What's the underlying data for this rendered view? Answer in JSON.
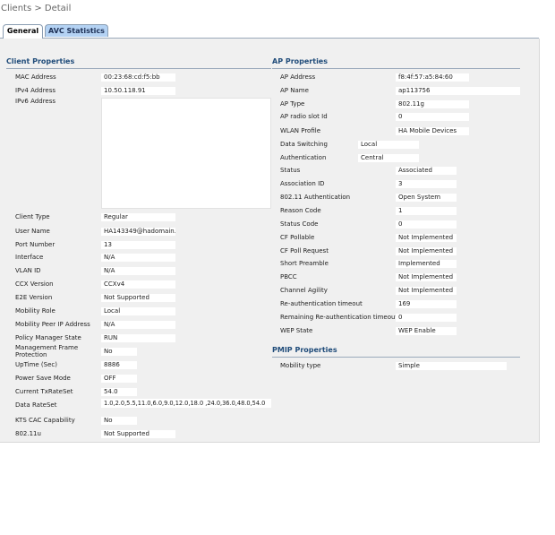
{
  "breadcrumb": "Clients > Detail",
  "tabs": [
    "General",
    "AVC Statistics"
  ],
  "client_properties": {
    "title": "Client Properties",
    "rows": [
      {
        "label": "MAC Address",
        "value": "00:23:68:cd:f5:bb"
      },
      {
        "label": "IPv4 Address",
        "value": "10.50.118.91"
      },
      {
        "label": "IPv6 Address",
        "value": ""
      },
      {
        "label": "Client Type",
        "value": "Regular"
      },
      {
        "label": "User Name",
        "value": "HA143349@hadomain.n"
      },
      {
        "label": "Port Number",
        "value": "13"
      },
      {
        "label": "Interface",
        "value": "N/A"
      },
      {
        "label": "VLAN ID",
        "value": "N/A"
      },
      {
        "label": "CCX Version",
        "value": "CCXv4"
      },
      {
        "label": "E2E Version",
        "value": "Not Supported"
      },
      {
        "label": "Mobility Role",
        "value": "Local"
      },
      {
        "label": "Mobility Peer IP Address",
        "value": "N/A"
      },
      {
        "label": "Policy Manager State",
        "value": "RUN"
      },
      {
        "label": "Management Frame Protection",
        "value": "No"
      },
      {
        "label": "UpTime (Sec)",
        "value": "8886"
      },
      {
        "label": "Power Save Mode",
        "value": "OFF"
      },
      {
        "label": "Current TxRateSet",
        "value": "54.0"
      },
      {
        "label": "Data RateSet",
        "value": "1.0,2.0,5.5,11.0,6.0,9.0,12.0,18.0 ,24.0,36.0,48.0,54.0"
      },
      {
        "label": "KTS CAC Capability",
        "value": "No"
      },
      {
        "label": "802.11u",
        "value": "Not Supported"
      }
    ]
  },
  "ap_properties": {
    "title": "AP Properties",
    "rows": [
      {
        "label": "AP Address",
        "value": "f8:4f:57:a5:84:60"
      },
      {
        "label": "AP Name",
        "value": "ap113756"
      },
      {
        "label": "AP Type",
        "value": "802.11g"
      },
      {
        "label": "AP radio slot Id",
        "value": "0"
      },
      {
        "label": "WLAN Profile",
        "value": "HA Mobile Devices"
      },
      {
        "label": "Data Switching",
        "value": "Local"
      },
      {
        "label": "Authentication",
        "value": "Central"
      },
      {
        "label": "Status",
        "value": "Associated"
      },
      {
        "label": "Association ID",
        "value": "3"
      },
      {
        "label": "802.11 Authentication",
        "value": "Open System"
      },
      {
        "label": "Reason Code",
        "value": "1"
      },
      {
        "label": "Status Code",
        "value": "0"
      },
      {
        "label": "CF Pollable",
        "value": "Not Implemented"
      },
      {
        "label": "CF Poll Request",
        "value": "Not Implemented"
      },
      {
        "label": "Short Preamble",
        "value": "Implemented"
      },
      {
        "label": "PBCC",
        "value": "Not Implemented"
      },
      {
        "label": "Channel Agility",
        "value": "Not Implemented"
      },
      {
        "label": "Re-authentication timeout",
        "value": "169"
      },
      {
        "label": "Remaining Re-authentication timeout",
        "value": "0"
      },
      {
        "label": "WEP State",
        "value": "WEP Enable"
      }
    ]
  },
  "pmip_properties": {
    "title": "PMIP Properties",
    "rows": [
      {
        "label": "Mobility type",
        "value": "Simple"
      }
    ]
  }
}
